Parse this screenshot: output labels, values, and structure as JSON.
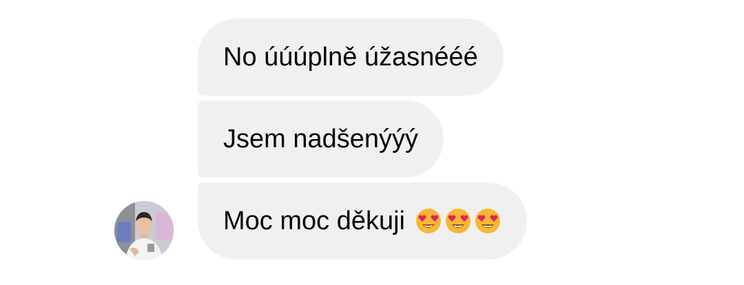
{
  "conversation": {
    "messages": [
      {
        "text": "No úúúplně úžasnééé"
      },
      {
        "text": "Jsem nadšenýýý"
      },
      {
        "text": "Moc moc děkuji",
        "emojis": [
          "heart-eyes",
          "heart-eyes",
          "heart-eyes"
        ]
      }
    ],
    "avatar": {
      "icon": "user-photo"
    }
  },
  "colors": {
    "bubble_background": "#f0f0f0",
    "text": "#050505",
    "emoji_face": "#f7b733",
    "emoji_heart": "#e0245e"
  }
}
